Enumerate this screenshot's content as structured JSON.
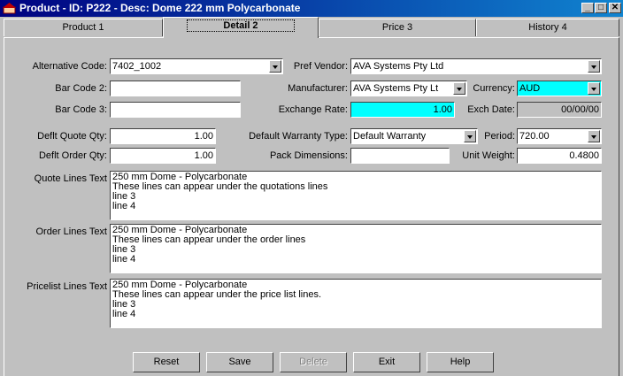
{
  "window": {
    "title": "Product - ID: P222  - Desc: Dome 222 mm Polycarbonate"
  },
  "tabs": [
    {
      "label": "Product 1"
    },
    {
      "label": "Detail 2"
    },
    {
      "label": "Price 3"
    },
    {
      "label": "History 4"
    }
  ],
  "form": {
    "alternative_code": {
      "label": "Alternative Code:",
      "value": "7402_1002"
    },
    "pref_vendor": {
      "label": "Pref Vendor:",
      "value": "AVA Systems Pty Ltd"
    },
    "bar_code_2": {
      "label": "Bar Code 2:",
      "value": ""
    },
    "manufacturer": {
      "label": "Manufacturer:",
      "value": "AVA Systems Pty Lt"
    },
    "currency": {
      "label": "Currency:",
      "value": "AUD"
    },
    "bar_code_3": {
      "label": "Bar Code 3:",
      "value": ""
    },
    "exchange_rate": {
      "label": "Exchange Rate:",
      "value": "1.00"
    },
    "exch_date": {
      "label": "Exch Date:",
      "value": "00/00/00"
    },
    "deflt_quote_qty": {
      "label": "Deflt Quote Qty:",
      "value": "1.00"
    },
    "default_warranty_type": {
      "label": "Default Warranty Type:",
      "value": "Default Warranty"
    },
    "period": {
      "label": "Period:",
      "value": "720.00"
    },
    "deflt_order_qty": {
      "label": "Deflt Order Qty:",
      "value": "1.00"
    },
    "pack_dimensions": {
      "label": "Pack Dimensions:",
      "value": ""
    },
    "unit_weight": {
      "label": "Unit Weight:",
      "value": "0.4800"
    },
    "quote_lines": {
      "label": "Quote Lines Text",
      "lines": [
        "250 mm Dome - Polycarbonate",
        "These lines can appear under the quotations lines",
        "line 3",
        "line 4"
      ]
    },
    "order_lines": {
      "label": "Order Lines Text",
      "lines": [
        "250 mm Dome - Polycarbonate",
        "These lines can appear under the order lines",
        "line 3",
        "line 4"
      ]
    },
    "pricelist_lines": {
      "label": "Pricelist Lines Text",
      "lines": [
        "250 mm Dome - Polycarbonate",
        "These lines can appear under the price list lines.",
        "line 3",
        "line 4"
      ]
    }
  },
  "buttons": {
    "reset": "Reset",
    "save": "Save",
    "delete": "Delete",
    "exit": "Exit",
    "help": "Help"
  },
  "colors": {
    "title_bar": "#000080",
    "highlight_field": "#00ffff",
    "face": "#c0c0c0"
  }
}
